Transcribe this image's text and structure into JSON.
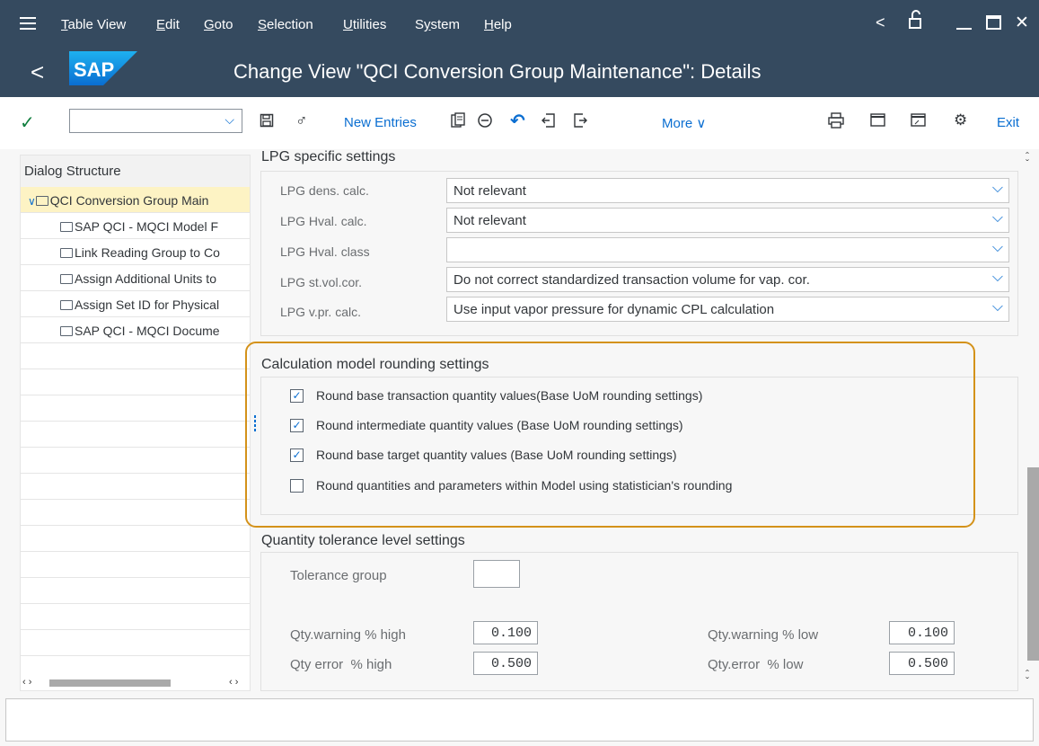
{
  "menu": {
    "items": [
      "Table View",
      "Edit",
      "Goto",
      "Selection",
      "Utilities",
      "System",
      "Help"
    ],
    "underline": [
      "T",
      "E",
      "G",
      "S",
      "U",
      "y",
      "H"
    ]
  },
  "window_controls": {
    "prev": "<",
    "lock": "🔓",
    "min": "_",
    "max": "☐",
    "close": "✕"
  },
  "titlebar": {
    "back": "<",
    "logo": "SAP",
    "title": "Change View \"QCI Conversion Group Maintenance\": Details"
  },
  "toolbar": {
    "command_field_value": "",
    "new_entries": "New Entries",
    "more": "More",
    "exit": "Exit"
  },
  "left_panel": {
    "header": "Dialog Structure",
    "items": [
      {
        "label": "QCI Conversion Group Main",
        "selected": true
      },
      {
        "label": "SAP QCI - MQCI Model F",
        "selected": false
      },
      {
        "label": "Link Reading Group to Co",
        "selected": false
      },
      {
        "label": "Assign Additional Units to",
        "selected": false
      },
      {
        "label": "Assign Set ID for Physical",
        "selected": false
      },
      {
        "label": "SAP QCI - MQCI Docume",
        "selected": false
      }
    ]
  },
  "lpg": {
    "title": "LPG specific settings",
    "rows": [
      {
        "label": "LPG dens. calc.",
        "value": "Not relevant"
      },
      {
        "label": "LPG Hval. calc.",
        "value": "Not relevant"
      },
      {
        "label": "LPG Hval. class",
        "value": ""
      },
      {
        "label": "LPG st.vol.cor.",
        "value": "Do not correct standardized transaction volume for vap. cor."
      },
      {
        "label": "LPG v.pr. calc.",
        "value": "Use input vapor pressure for dynamic CPL calculation"
      }
    ]
  },
  "rounding": {
    "title": "Calculation model rounding settings",
    "items": [
      {
        "label": "Round base transaction quantity values(Base UoM rounding settings)",
        "checked": true,
        "mark": "✓"
      },
      {
        "label": "Round intermediate quantity values (Base UoM rounding settings)",
        "checked": true,
        "mark": "✓"
      },
      {
        "label": "Round base target quantity values (Base UoM rounding settings)",
        "checked": true,
        "mark": "✓"
      },
      {
        "label": "Round quantities and parameters within Model using statistician's rounding",
        "checked": false,
        "mark": ""
      }
    ]
  },
  "tolerance": {
    "title": "Quantity tolerance level settings",
    "group_label": "Tolerance group",
    "group_value": "",
    "warn_high_label": "Qty.warning % high",
    "warn_high_value": "0.100",
    "warn_low_label": "Qty.warning % low",
    "warn_low_value": "0.100",
    "err_high_label": "Qty error  % high",
    "err_high_value": "0.500",
    "err_low_label": "Qty.error  % low",
    "err_low_value": "0.500"
  },
  "colors": {
    "shell": "#354a5f",
    "accent": "#0a6ed1",
    "highlight": "#d4921a",
    "selected_row": "#fdf3c4"
  }
}
